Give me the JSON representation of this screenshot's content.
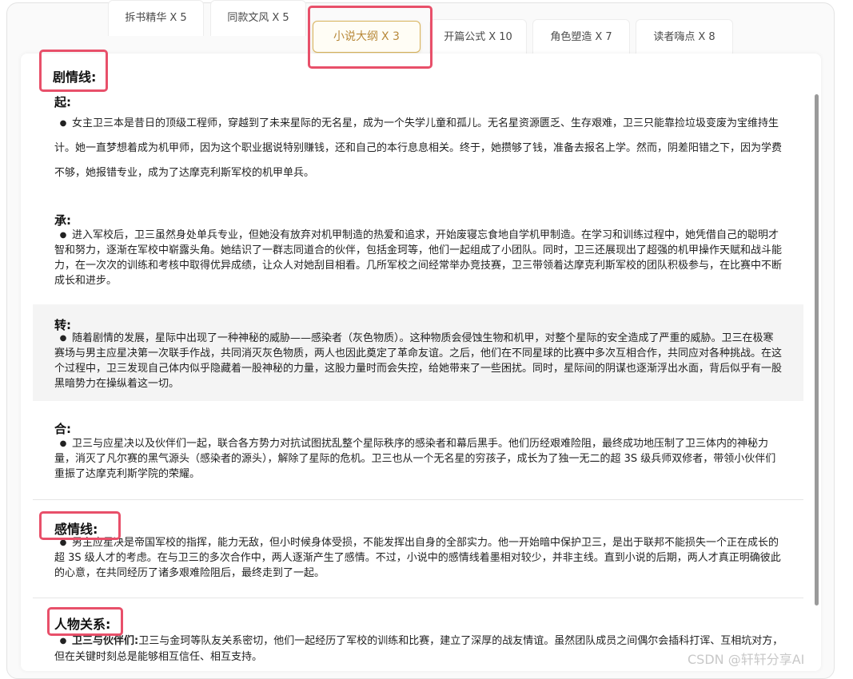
{
  "tabs": [
    {
      "label": "拆书精华",
      "count": "X 5"
    },
    {
      "label": "同款文风",
      "count": "X 5"
    },
    {
      "label": "小说大纲",
      "count": "X 3",
      "active": true
    },
    {
      "label": "开篇公式",
      "count": "X 10"
    },
    {
      "label": "角色塑造",
      "count": "X 7"
    },
    {
      "label": "读者嗨点",
      "count": "X 8"
    }
  ],
  "plot": {
    "title": "剧情线:",
    "qi": {
      "label": "起:",
      "text": "女主卫三本是昔日的顶级工程师，穿越到了未来星际的无名星，成为一个失学儿童和孤儿。无名星资源匮乏、生存艰难，卫三只能靠捡垃圾变废为宝维持生计。她一直梦想着成为机甲师，因为这个职业据说特别赚钱，还和自己的本行息息相关。终于，她攒够了钱，准备去报名上学。然而，阴差阳错之下，因为学费不够，她报错专业，成为了达摩克利斯军校的机甲单兵。"
    },
    "cheng": {
      "label": "承:",
      "text": "进入军校后，卫三虽然身处单兵专业，但她没有放弃对机甲制造的热爱和追求，开始废寝忘食地自学机甲制造。在学习和训练过程中，她凭借自己的聪明才智和努力，逐渐在军校中崭露头角。她结识了一群志同道合的伙伴，包括金珂等，他们一起组成了小团队。同时，卫三还展现出了超强的机甲操作天赋和战斗能力，在一次次的训练和考核中取得优异成绩，让众人对她刮目相看。几所军校之间经常举办竞技赛，卫三带领着达摩克利斯军校的团队积极参与，在比赛中不断成长和进步。"
    },
    "zhuan": {
      "label": "转:",
      "text": "随着剧情的发展，星际中出现了一种神秘的威胁——感染者（灰色物质）。这种物质会侵蚀生物和机甲，对整个星际的安全造成了严重的威胁。卫三在极寒赛场与男主应星决第一次联手作战，共同消灭灰色物质，两人也因此奠定了革命友谊。之后，他们在不同星球的比赛中多次互相合作，共同应对各种挑战。在这个过程中，卫三发现自己体内似乎隐藏着一股神秘的力量，这股力量时而会失控，给她带来了一些困扰。同时，星际间的阴谋也逐渐浮出水面，背后似乎有一股黑暗势力在操纵着这一切。"
    },
    "he": {
      "label": "合:",
      "text": "卫三与应星决以及伙伴们一起，联合各方势力对抗试图扰乱整个星际秩序的感染者和幕后黑手。他们历经艰难险阻，最终成功地压制了卫三体内的神秘力量，消灭了凡尔赛的黑气源头（感染者的源头），解除了星际的危机。卫三也从一个无名星的穷孩子，成长为了独一无二的超 3S 级兵师双修者，带领小伙伴们重振了达摩克利斯学院的荣耀。"
    }
  },
  "romance": {
    "title": "感情线:",
    "text": "男主应星决是帝国军校的指挥，能力无敌，但小时候身体受损，不能发挥出自身的全部实力。他一开始暗中保护卫三，是出于联邦不能损失一个正在成长的超 3S 级人才的考虑。在与卫三的多次合作中，两人逐渐产生了感情。不过，小说中的感情线着墨相对较少，并非主线。直到小说的后期，两人才真正明确彼此的心意，在共同经历了诸多艰难险阻后，最终走到了一起。"
  },
  "relations": {
    "title": "人物关系:",
    "item_label": "卫三与伙伴们:",
    "item_text": "卫三与金珂等队友关系密切，他们一起经历了军校的训练和比赛，建立了深厚的战友情谊。虽然团队成员之间偶尔会插科打诨、互相坑对方，但在关键时刻总是能够相互信任、相互支持。"
  },
  "watermark": "CSDN @轩轩分享AI",
  "colors": {
    "highlight": "#e8506a",
    "active_tab": "#b8893a"
  }
}
